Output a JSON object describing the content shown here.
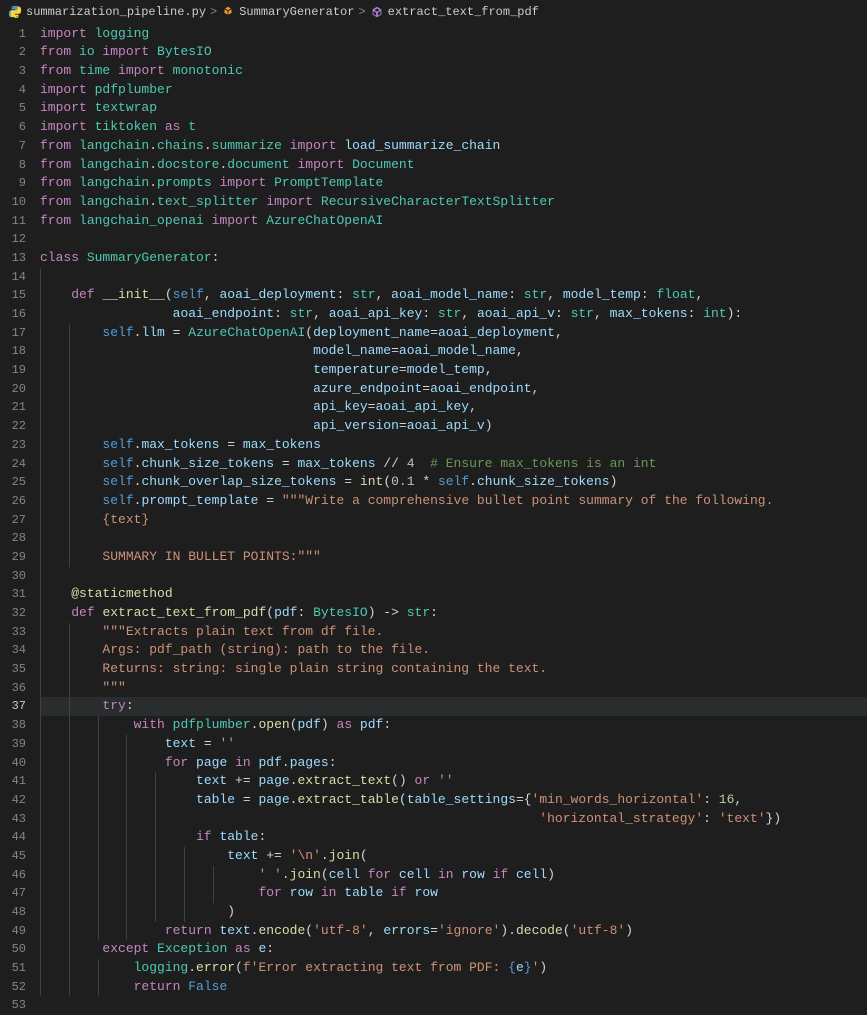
{
  "breadcrumb": {
    "file": "summarization_pipeline.py",
    "class": "SummaryGenerator",
    "method": "extract_text_from_pdf"
  },
  "sep": ">",
  "active_line": 37,
  "lines": [
    {
      "n": 1,
      "ind": 0,
      "t": [
        [
          "kw",
          "import "
        ],
        [
          "mod",
          "logging"
        ]
      ]
    },
    {
      "n": 2,
      "ind": 0,
      "t": [
        [
          "kw",
          "from "
        ],
        [
          "mod",
          "io"
        ],
        [
          "kw",
          " import "
        ],
        [
          "mod",
          "BytesIO"
        ]
      ]
    },
    {
      "n": 3,
      "ind": 0,
      "t": [
        [
          "kw",
          "from "
        ],
        [
          "mod",
          "time"
        ],
        [
          "kw",
          " import "
        ],
        [
          "mod",
          "monotonic"
        ]
      ]
    },
    {
      "n": 4,
      "ind": 0,
      "t": [
        [
          "kw",
          "import "
        ],
        [
          "mod",
          "pdfplumber"
        ]
      ]
    },
    {
      "n": 5,
      "ind": 0,
      "t": [
        [
          "kw",
          "import "
        ],
        [
          "mod",
          "textwrap"
        ]
      ]
    },
    {
      "n": 6,
      "ind": 0,
      "t": [
        [
          "kw",
          "import "
        ],
        [
          "mod",
          "tiktoken"
        ],
        [
          "kw",
          " as "
        ],
        [
          "mod",
          "t"
        ]
      ]
    },
    {
      "n": 7,
      "ind": 0,
      "t": [
        [
          "kw",
          "from "
        ],
        [
          "mod",
          "langchain"
        ],
        [
          "pn",
          "."
        ],
        [
          "mod",
          "chains"
        ],
        [
          "pn",
          "."
        ],
        [
          "mod",
          "summarize"
        ],
        [
          "kw",
          " import "
        ],
        [
          "var",
          "load_summarize_chain"
        ]
      ]
    },
    {
      "n": 8,
      "ind": 0,
      "t": [
        [
          "kw",
          "from "
        ],
        [
          "mod",
          "langchain"
        ],
        [
          "pn",
          "."
        ],
        [
          "mod",
          "docstore"
        ],
        [
          "pn",
          "."
        ],
        [
          "mod",
          "document"
        ],
        [
          "kw",
          " import "
        ],
        [
          "mod",
          "Document"
        ]
      ]
    },
    {
      "n": 9,
      "ind": 0,
      "t": [
        [
          "kw",
          "from "
        ],
        [
          "mod",
          "langchain"
        ],
        [
          "pn",
          "."
        ],
        [
          "mod",
          "prompts"
        ],
        [
          "kw",
          " import "
        ],
        [
          "mod",
          "PromptTemplate"
        ]
      ]
    },
    {
      "n": 10,
      "ind": 0,
      "t": [
        [
          "kw",
          "from "
        ],
        [
          "mod",
          "langchain"
        ],
        [
          "pn",
          "."
        ],
        [
          "mod",
          "text_splitter"
        ],
        [
          "kw",
          " import "
        ],
        [
          "mod",
          "RecursiveCharacterTextSplitter"
        ]
      ]
    },
    {
      "n": 11,
      "ind": 0,
      "t": [
        [
          "kw",
          "from "
        ],
        [
          "mod",
          "langchain_openai"
        ],
        [
          "kw",
          " import "
        ],
        [
          "mod",
          "AzureChatOpenAI"
        ]
      ]
    },
    {
      "n": 12,
      "ind": 0,
      "t": []
    },
    {
      "n": 13,
      "ind": 0,
      "t": [
        [
          "kw",
          "class "
        ],
        [
          "cls",
          "SummaryGenerator"
        ],
        [
          "pn",
          ":"
        ]
      ]
    },
    {
      "n": 14,
      "ind": 1,
      "t": []
    },
    {
      "n": 15,
      "ind": 1,
      "t": [
        [
          "kw",
          "def "
        ],
        [
          "fn",
          "__init__"
        ],
        [
          "pn",
          "("
        ],
        [
          "self",
          "self"
        ],
        [
          "pn",
          ", "
        ],
        [
          "var",
          "aoai_deployment"
        ],
        [
          "pn",
          ": "
        ],
        [
          "type",
          "str"
        ],
        [
          "pn",
          ", "
        ],
        [
          "var",
          "aoai_model_name"
        ],
        [
          "pn",
          ": "
        ],
        [
          "type",
          "str"
        ],
        [
          "pn",
          ", "
        ],
        [
          "var",
          "model_temp"
        ],
        [
          "pn",
          ": "
        ],
        [
          "type",
          "float"
        ],
        [
          "pn",
          ","
        ]
      ]
    },
    {
      "n": 16,
      "ind": 1,
      "t": [
        [
          "pn",
          "             "
        ],
        [
          "var",
          "aoai_endpoint"
        ],
        [
          "pn",
          ": "
        ],
        [
          "type",
          "str"
        ],
        [
          "pn",
          ", "
        ],
        [
          "var",
          "aoai_api_key"
        ],
        [
          "pn",
          ": "
        ],
        [
          "type",
          "str"
        ],
        [
          "pn",
          ", "
        ],
        [
          "var",
          "aoai_api_v"
        ],
        [
          "pn",
          ": "
        ],
        [
          "type",
          "str"
        ],
        [
          "pn",
          ", "
        ],
        [
          "var",
          "max_tokens"
        ],
        [
          "pn",
          ": "
        ],
        [
          "type",
          "int"
        ],
        [
          "pn",
          "):"
        ]
      ]
    },
    {
      "n": 17,
      "ind": 2,
      "t": [
        [
          "self",
          "self"
        ],
        [
          "pn",
          "."
        ],
        [
          "prop",
          "llm"
        ],
        [
          "pn",
          " = "
        ],
        [
          "cls",
          "AzureChatOpenAI"
        ],
        [
          "pn",
          "("
        ],
        [
          "var",
          "deployment_name"
        ],
        [
          "pn",
          "="
        ],
        [
          "var",
          "aoai_deployment"
        ],
        [
          "pn",
          ","
        ]
      ]
    },
    {
      "n": 18,
      "ind": 2,
      "t": [
        [
          "pn",
          "                           "
        ],
        [
          "var",
          "model_name"
        ],
        [
          "pn",
          "="
        ],
        [
          "var",
          "aoai_model_name"
        ],
        [
          "pn",
          ","
        ]
      ]
    },
    {
      "n": 19,
      "ind": 2,
      "t": [
        [
          "pn",
          "                           "
        ],
        [
          "var",
          "temperature"
        ],
        [
          "pn",
          "="
        ],
        [
          "var",
          "model_temp"
        ],
        [
          "pn",
          ","
        ]
      ]
    },
    {
      "n": 20,
      "ind": 2,
      "t": [
        [
          "pn",
          "                           "
        ],
        [
          "var",
          "azure_endpoint"
        ],
        [
          "pn",
          "="
        ],
        [
          "var",
          "aoai_endpoint"
        ],
        [
          "pn",
          ","
        ]
      ]
    },
    {
      "n": 21,
      "ind": 2,
      "t": [
        [
          "pn",
          "                           "
        ],
        [
          "var",
          "api_key"
        ],
        [
          "pn",
          "="
        ],
        [
          "var",
          "aoai_api_key"
        ],
        [
          "pn",
          ","
        ]
      ]
    },
    {
      "n": 22,
      "ind": 2,
      "t": [
        [
          "pn",
          "                           "
        ],
        [
          "var",
          "api_version"
        ],
        [
          "pn",
          "="
        ],
        [
          "var",
          "aoai_api_v"
        ],
        [
          "pn",
          ")"
        ]
      ]
    },
    {
      "n": 23,
      "ind": 2,
      "t": [
        [
          "self",
          "self"
        ],
        [
          "pn",
          "."
        ],
        [
          "prop",
          "max_tokens"
        ],
        [
          "pn",
          " = "
        ],
        [
          "var",
          "max_tokens"
        ]
      ]
    },
    {
      "n": 24,
      "ind": 2,
      "t": [
        [
          "self",
          "self"
        ],
        [
          "pn",
          "."
        ],
        [
          "prop",
          "chunk_size_tokens"
        ],
        [
          "pn",
          " = "
        ],
        [
          "var",
          "max_tokens"
        ],
        [
          "pn",
          " // "
        ],
        [
          "num",
          "4"
        ],
        [
          "pn",
          "  "
        ],
        [
          "cmt",
          "# Ensure max_tokens is an int"
        ]
      ]
    },
    {
      "n": 25,
      "ind": 2,
      "t": [
        [
          "self",
          "self"
        ],
        [
          "pn",
          "."
        ],
        [
          "prop",
          "chunk_overlap_size_tokens"
        ],
        [
          "pn",
          " = "
        ],
        [
          "fn",
          "int"
        ],
        [
          "pn",
          "("
        ],
        [
          "num",
          "0.1"
        ],
        [
          "pn",
          " * "
        ],
        [
          "self",
          "self"
        ],
        [
          "pn",
          "."
        ],
        [
          "prop",
          "chunk_size_tokens"
        ],
        [
          "pn",
          ")"
        ]
      ]
    },
    {
      "n": 26,
      "ind": 2,
      "t": [
        [
          "self",
          "self"
        ],
        [
          "pn",
          "."
        ],
        [
          "prop",
          "prompt_template"
        ],
        [
          "pn",
          " = "
        ],
        [
          "str",
          "\"\"\"Write a comprehensive bullet point summary of the following."
        ]
      ]
    },
    {
      "n": 27,
      "ind": 2,
      "t": [
        [
          "str",
          "{text}"
        ]
      ]
    },
    {
      "n": 28,
      "ind": 2,
      "t": []
    },
    {
      "n": 29,
      "ind": 2,
      "t": [
        [
          "str",
          "SUMMARY IN BULLET POINTS:\"\"\""
        ]
      ]
    },
    {
      "n": 30,
      "ind": 1,
      "t": []
    },
    {
      "n": 31,
      "ind": 1,
      "t": [
        [
          "deco",
          "@staticmethod"
        ]
      ]
    },
    {
      "n": 32,
      "ind": 1,
      "t": [
        [
          "kw",
          "def "
        ],
        [
          "fn",
          "extract_text_from_pdf"
        ],
        [
          "pn",
          "("
        ],
        [
          "var",
          "pdf"
        ],
        [
          "pn",
          ": "
        ],
        [
          "cls",
          "BytesIO"
        ],
        [
          "pn",
          ") -> "
        ],
        [
          "type",
          "str"
        ],
        [
          "pn",
          ":"
        ]
      ]
    },
    {
      "n": 33,
      "ind": 2,
      "t": [
        [
          "str",
          "\"\"\"Extracts plain text from df file."
        ]
      ]
    },
    {
      "n": 34,
      "ind": 2,
      "t": [
        [
          "str",
          "Args: pdf_path (string): path to the file."
        ]
      ]
    },
    {
      "n": 35,
      "ind": 2,
      "t": [
        [
          "str",
          "Returns: string: single plain string containing the text."
        ]
      ]
    },
    {
      "n": 36,
      "ind": 2,
      "t": [
        [
          "str",
          "\"\"\""
        ]
      ]
    },
    {
      "n": 37,
      "ind": 2,
      "t": [
        [
          "kw",
          "try"
        ],
        [
          "pn",
          ":"
        ]
      ]
    },
    {
      "n": 38,
      "ind": 3,
      "t": [
        [
          "kw",
          "with "
        ],
        [
          "mod",
          "pdfplumber"
        ],
        [
          "pn",
          "."
        ],
        [
          "fn",
          "open"
        ],
        [
          "pn",
          "("
        ],
        [
          "var",
          "pdf"
        ],
        [
          "pn",
          ") "
        ],
        [
          "kw",
          "as "
        ],
        [
          "var",
          "pdf"
        ],
        [
          "pn",
          ":"
        ]
      ]
    },
    {
      "n": 39,
      "ind": 4,
      "t": [
        [
          "var",
          "text"
        ],
        [
          "pn",
          " = "
        ],
        [
          "str",
          "''"
        ]
      ]
    },
    {
      "n": 40,
      "ind": 4,
      "t": [
        [
          "kw",
          "for "
        ],
        [
          "var",
          "page"
        ],
        [
          "kw",
          " in "
        ],
        [
          "var",
          "pdf"
        ],
        [
          "pn",
          "."
        ],
        [
          "prop",
          "pages"
        ],
        [
          "pn",
          ":"
        ]
      ]
    },
    {
      "n": 41,
      "ind": 5,
      "t": [
        [
          "var",
          "text"
        ],
        [
          "pn",
          " += "
        ],
        [
          "var",
          "page"
        ],
        [
          "pn",
          "."
        ],
        [
          "fn",
          "extract_text"
        ],
        [
          "pn",
          "() "
        ],
        [
          "kw",
          "or "
        ],
        [
          "str",
          "''"
        ]
      ]
    },
    {
      "n": 42,
      "ind": 5,
      "t": [
        [
          "var",
          "table"
        ],
        [
          "pn",
          " = "
        ],
        [
          "var",
          "page"
        ],
        [
          "pn",
          "."
        ],
        [
          "fn",
          "extract_table"
        ],
        [
          "pn",
          "("
        ],
        [
          "var",
          "table_settings"
        ],
        [
          "pn",
          "={"
        ],
        [
          "str",
          "'min_words_horizontal'"
        ],
        [
          "pn",
          ": "
        ],
        [
          "num",
          "16"
        ],
        [
          "pn",
          ","
        ]
      ]
    },
    {
      "n": 43,
      "ind": 5,
      "t": [
        [
          "pn",
          "                                            "
        ],
        [
          "str",
          "'horizontal_strategy'"
        ],
        [
          "pn",
          ": "
        ],
        [
          "str",
          "'text'"
        ],
        [
          "pn",
          "})"
        ]
      ]
    },
    {
      "n": 44,
      "ind": 5,
      "t": [
        [
          "kw",
          "if "
        ],
        [
          "var",
          "table"
        ],
        [
          "pn",
          ":"
        ]
      ]
    },
    {
      "n": 45,
      "ind": 6,
      "t": [
        [
          "var",
          "text"
        ],
        [
          "pn",
          " += "
        ],
        [
          "str",
          "'\\n'"
        ],
        [
          "pn",
          "."
        ],
        [
          "fn",
          "join"
        ],
        [
          "pn",
          "("
        ]
      ]
    },
    {
      "n": 46,
      "ind": 7,
      "t": [
        [
          "str",
          "' '"
        ],
        [
          "pn",
          "."
        ],
        [
          "fn",
          "join"
        ],
        [
          "pn",
          "("
        ],
        [
          "var",
          "cell"
        ],
        [
          "kw",
          " for "
        ],
        [
          "var",
          "cell"
        ],
        [
          "kw",
          " in "
        ],
        [
          "var",
          "row"
        ],
        [
          "kw",
          " if "
        ],
        [
          "var",
          "cell"
        ],
        [
          "pn",
          ")"
        ]
      ]
    },
    {
      "n": 47,
      "ind": 7,
      "t": [
        [
          "kw",
          "for "
        ],
        [
          "var",
          "row"
        ],
        [
          "kw",
          " in "
        ],
        [
          "var",
          "table"
        ],
        [
          "kw",
          " if "
        ],
        [
          "var",
          "row"
        ]
      ]
    },
    {
      "n": 48,
      "ind": 6,
      "t": [
        [
          "pn",
          ")"
        ]
      ]
    },
    {
      "n": 49,
      "ind": 4,
      "t": [
        [
          "kw",
          "return "
        ],
        [
          "var",
          "text"
        ],
        [
          "pn",
          "."
        ],
        [
          "fn",
          "encode"
        ],
        [
          "pn",
          "("
        ],
        [
          "str",
          "'utf-8'"
        ],
        [
          "pn",
          ", "
        ],
        [
          "var",
          "errors"
        ],
        [
          "pn",
          "="
        ],
        [
          "str",
          "'ignore'"
        ],
        [
          "pn",
          ")."
        ],
        [
          "fn",
          "decode"
        ],
        [
          "pn",
          "("
        ],
        [
          "str",
          "'utf-8'"
        ],
        [
          "pn",
          ")"
        ]
      ]
    },
    {
      "n": 50,
      "ind": 2,
      "t": [
        [
          "kw",
          "except "
        ],
        [
          "cls",
          "Exception"
        ],
        [
          "kw",
          " as "
        ],
        [
          "var",
          "e"
        ],
        [
          "pn",
          ":"
        ]
      ]
    },
    {
      "n": 51,
      "ind": 3,
      "t": [
        [
          "mod",
          "logging"
        ],
        [
          "pn",
          "."
        ],
        [
          "fn",
          "error"
        ],
        [
          "pn",
          "("
        ],
        [
          "str",
          "f'Error extracting text from PDF: "
        ],
        [
          "const",
          "{"
        ],
        [
          "var",
          "e"
        ],
        [
          "const",
          "}"
        ],
        [
          "str",
          "'"
        ],
        [
          "pn",
          ")"
        ]
      ]
    },
    {
      "n": 52,
      "ind": 3,
      "t": [
        [
          "kw",
          "return "
        ],
        [
          "const",
          "False"
        ]
      ]
    },
    {
      "n": 53,
      "ind": 0,
      "t": []
    }
  ]
}
